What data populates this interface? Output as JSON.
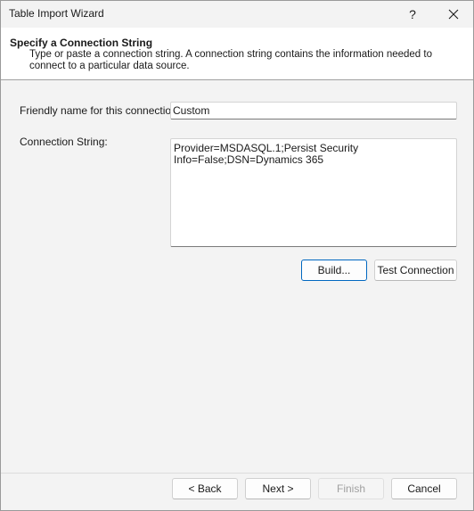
{
  "window": {
    "title": "Table Import Wizard",
    "help_glyph": "?"
  },
  "header": {
    "title": "Specify a Connection String",
    "description": "Type or paste a connection string. A connection string contains the information needed to connect to a particular data source."
  },
  "form": {
    "friendly_name_label": "Friendly name for this connection:",
    "friendly_name_value": "Custom",
    "connection_string_label": "Connection String:",
    "connection_string_value": "Provider=MSDASQL.1;Persist Security Info=False;DSN=Dynamics 365"
  },
  "actions": {
    "build_label": "Build...",
    "test_connection_label": "Test Connection"
  },
  "footer": {
    "back_label": "< Back",
    "next_label": "Next >",
    "finish_label": "Finish",
    "cancel_label": "Cancel",
    "finish_enabled": false
  },
  "icons": {
    "close": "close-icon"
  },
  "colors": {
    "accent": "#0067c0",
    "background": "#f3f3f3",
    "header_background": "#ffffff"
  }
}
